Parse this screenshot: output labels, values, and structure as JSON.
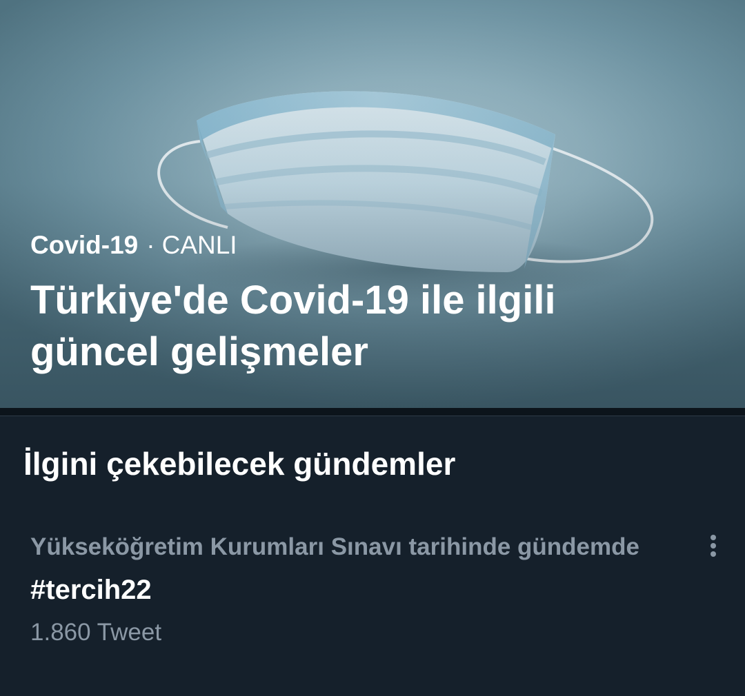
{
  "hero": {
    "topic": "Covid-19",
    "separator": "·",
    "status": "CANLI",
    "title": "Türkiye'de Covid-19 ile ilgili güncel gelişmeler",
    "image_subject": "surgical-mask-photo"
  },
  "section": {
    "title": "İlgini çekebilecek gündemler"
  },
  "trend": {
    "context": "Yükseköğretim Kurumları Sınavı tarihinde gündemde",
    "name": "#tercih22",
    "count": "1.860 Tweet",
    "more_icon": "more-vertical-icon"
  },
  "colors": {
    "background": "#15202b",
    "divider": "#0c141b",
    "secondary_text": "#8b98a5",
    "primary_text": "#ffffff"
  }
}
